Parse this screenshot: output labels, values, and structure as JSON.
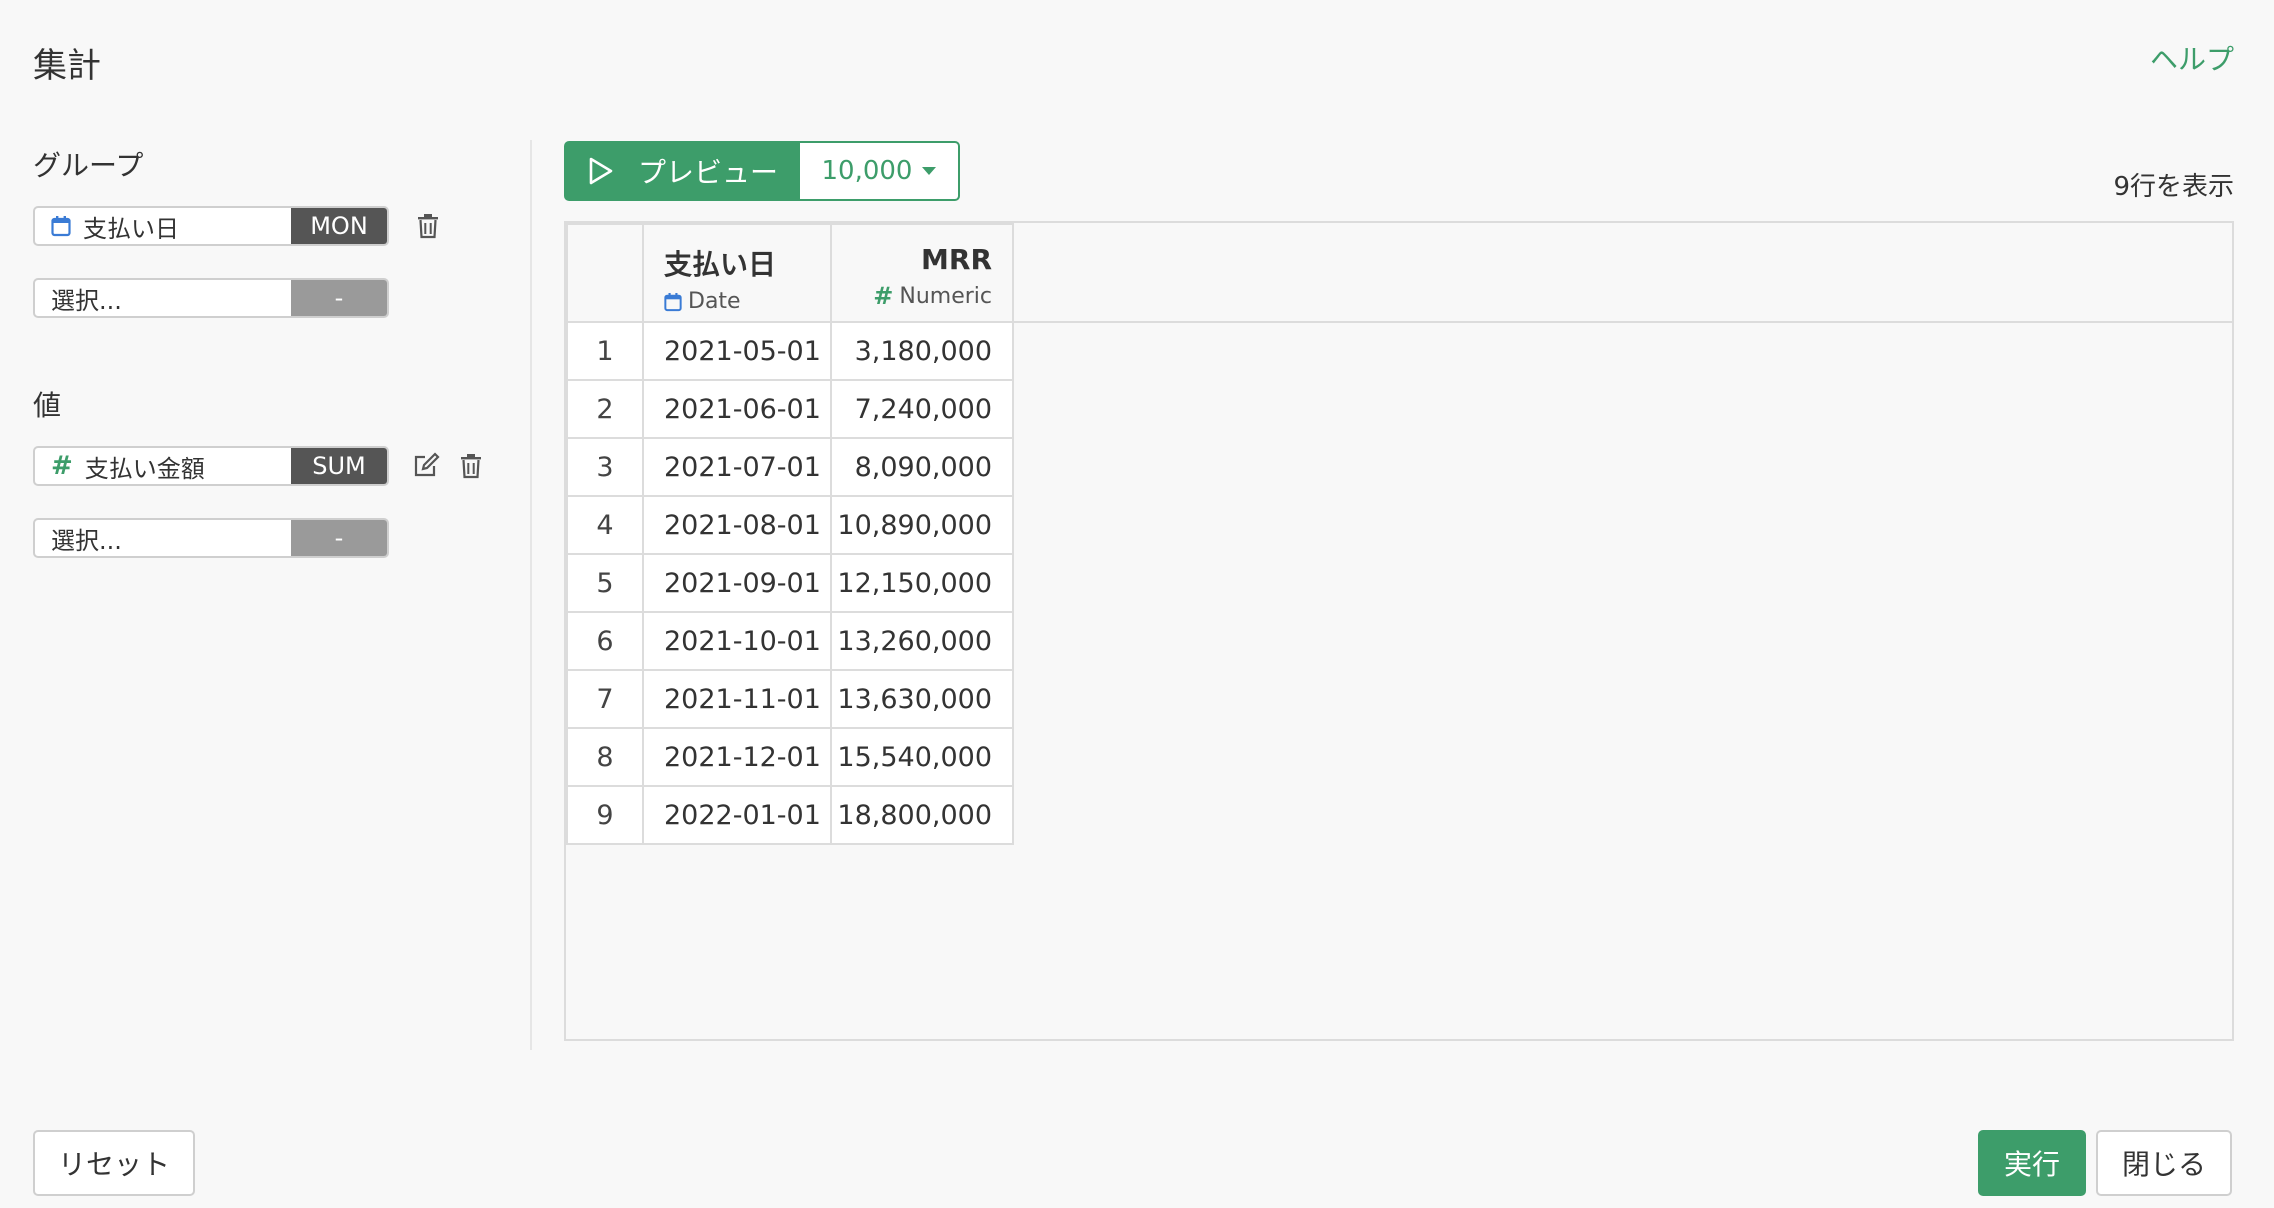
{
  "header": {
    "title": "集計",
    "help_label": "ヘルプ"
  },
  "group": {
    "label": "グループ",
    "field": {
      "name": "支払い日",
      "agg": "MON",
      "icon": "calendar-icon"
    },
    "empty_field": {
      "placeholder": "選択...",
      "agg": "-"
    }
  },
  "values": {
    "label": "値",
    "field": {
      "name": "支払い金額",
      "agg": "SUM",
      "icon": "numeric-hash-icon"
    },
    "empty_field": {
      "placeholder": "選択...",
      "agg": "-"
    }
  },
  "preview": {
    "label": "プレビュー",
    "limit": "10,000",
    "row_count_text": "9行を表示"
  },
  "table": {
    "columns": [
      {
        "name": "支払い日",
        "type": "Date",
        "icon": "calendar-icon"
      },
      {
        "name": "MRR",
        "type": "Numeric",
        "icon": "numeric-hash-icon"
      }
    ],
    "rows": [
      {
        "idx": "1",
        "date": "2021-05-01",
        "mrr": "3,180,000"
      },
      {
        "idx": "2",
        "date": "2021-06-01",
        "mrr": "7,240,000"
      },
      {
        "idx": "3",
        "date": "2021-07-01",
        "mrr": "8,090,000"
      },
      {
        "idx": "4",
        "date": "2021-08-01",
        "mrr": "10,890,000"
      },
      {
        "idx": "5",
        "date": "2021-09-01",
        "mrr": "12,150,000"
      },
      {
        "idx": "6",
        "date": "2021-10-01",
        "mrr": "13,260,000"
      },
      {
        "idx": "7",
        "date": "2021-11-01",
        "mrr": "13,630,000"
      },
      {
        "idx": "8",
        "date": "2021-12-01",
        "mrr": "15,540,000"
      },
      {
        "idx": "9",
        "date": "2022-01-01",
        "mrr": "18,800,000"
      }
    ]
  },
  "footer": {
    "reset_label": "リセット",
    "run_label": "実行",
    "close_label": "閉じる"
  },
  "colors": {
    "accent": "#3d9d6a",
    "calendar": "#3a7bd5",
    "agg_dark": "#555555",
    "agg_light": "#9a9a9a"
  }
}
